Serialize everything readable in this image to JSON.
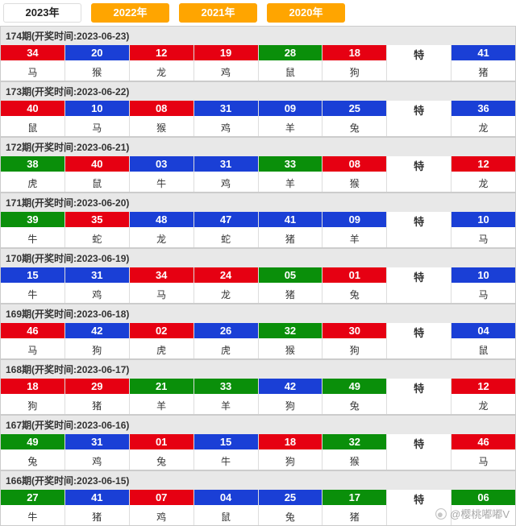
{
  "tabs": [
    "2023年",
    "2022年",
    "2021年",
    "2020年"
  ],
  "active_tab": 0,
  "special_label": "特",
  "watermark": "@樱桃嘟嘟V",
  "periods": [
    {
      "title": "174期(开奖时间:2023-06-23)",
      "balls": [
        {
          "n": "34",
          "z": "马",
          "c": "red"
        },
        {
          "n": "20",
          "z": "猴",
          "c": "blue"
        },
        {
          "n": "12",
          "z": "龙",
          "c": "red"
        },
        {
          "n": "19",
          "z": "鸡",
          "c": "red"
        },
        {
          "n": "28",
          "z": "鼠",
          "c": "green"
        },
        {
          "n": "18",
          "z": "狗",
          "c": "red"
        },
        {
          "n": "特",
          "z": "",
          "c": "spec"
        },
        {
          "n": "41",
          "z": "猪",
          "c": "blue"
        }
      ]
    },
    {
      "title": "173期(开奖时间:2023-06-22)",
      "balls": [
        {
          "n": "40",
          "z": "鼠",
          "c": "red"
        },
        {
          "n": "10",
          "z": "马",
          "c": "blue"
        },
        {
          "n": "08",
          "z": "猴",
          "c": "red"
        },
        {
          "n": "31",
          "z": "鸡",
          "c": "blue"
        },
        {
          "n": "09",
          "z": "羊",
          "c": "blue"
        },
        {
          "n": "25",
          "z": "兔",
          "c": "blue"
        },
        {
          "n": "特",
          "z": "",
          "c": "spec"
        },
        {
          "n": "36",
          "z": "龙",
          "c": "blue"
        }
      ]
    },
    {
      "title": "172期(开奖时间:2023-06-21)",
      "balls": [
        {
          "n": "38",
          "z": "虎",
          "c": "green"
        },
        {
          "n": "40",
          "z": "鼠",
          "c": "red"
        },
        {
          "n": "03",
          "z": "牛",
          "c": "blue"
        },
        {
          "n": "31",
          "z": "鸡",
          "c": "blue"
        },
        {
          "n": "33",
          "z": "羊",
          "c": "green"
        },
        {
          "n": "08",
          "z": "猴",
          "c": "red"
        },
        {
          "n": "特",
          "z": "",
          "c": "spec"
        },
        {
          "n": "12",
          "z": "龙",
          "c": "red"
        }
      ]
    },
    {
      "title": "171期(开奖时间:2023-06-20)",
      "balls": [
        {
          "n": "39",
          "z": "牛",
          "c": "green"
        },
        {
          "n": "35",
          "z": "蛇",
          "c": "red"
        },
        {
          "n": "48",
          "z": "龙",
          "c": "blue"
        },
        {
          "n": "47",
          "z": "蛇",
          "c": "blue"
        },
        {
          "n": "41",
          "z": "猪",
          "c": "blue"
        },
        {
          "n": "09",
          "z": "羊",
          "c": "blue"
        },
        {
          "n": "特",
          "z": "",
          "c": "spec"
        },
        {
          "n": "10",
          "z": "马",
          "c": "blue"
        }
      ]
    },
    {
      "title": "170期(开奖时间:2023-06-19)",
      "balls": [
        {
          "n": "15",
          "z": "牛",
          "c": "blue"
        },
        {
          "n": "31",
          "z": "鸡",
          "c": "blue"
        },
        {
          "n": "34",
          "z": "马",
          "c": "red"
        },
        {
          "n": "24",
          "z": "龙",
          "c": "red"
        },
        {
          "n": "05",
          "z": "猪",
          "c": "green"
        },
        {
          "n": "01",
          "z": "兔",
          "c": "red"
        },
        {
          "n": "特",
          "z": "",
          "c": "spec"
        },
        {
          "n": "10",
          "z": "马",
          "c": "blue"
        }
      ]
    },
    {
      "title": "169期(开奖时间:2023-06-18)",
      "balls": [
        {
          "n": "46",
          "z": "马",
          "c": "red"
        },
        {
          "n": "42",
          "z": "狗",
          "c": "blue"
        },
        {
          "n": "02",
          "z": "虎",
          "c": "red"
        },
        {
          "n": "26",
          "z": "虎",
          "c": "blue"
        },
        {
          "n": "32",
          "z": "猴",
          "c": "green"
        },
        {
          "n": "30",
          "z": "狗",
          "c": "red"
        },
        {
          "n": "特",
          "z": "",
          "c": "spec"
        },
        {
          "n": "04",
          "z": "鼠",
          "c": "blue"
        }
      ]
    },
    {
      "title": "168期(开奖时间:2023-06-17)",
      "balls": [
        {
          "n": "18",
          "z": "狗",
          "c": "red"
        },
        {
          "n": "29",
          "z": "猪",
          "c": "red"
        },
        {
          "n": "21",
          "z": "羊",
          "c": "green"
        },
        {
          "n": "33",
          "z": "羊",
          "c": "green"
        },
        {
          "n": "42",
          "z": "狗",
          "c": "blue"
        },
        {
          "n": "49",
          "z": "兔",
          "c": "green"
        },
        {
          "n": "特",
          "z": "",
          "c": "spec"
        },
        {
          "n": "12",
          "z": "龙",
          "c": "red"
        }
      ]
    },
    {
      "title": "167期(开奖时间:2023-06-16)",
      "balls": [
        {
          "n": "49",
          "z": "兔",
          "c": "green"
        },
        {
          "n": "31",
          "z": "鸡",
          "c": "blue"
        },
        {
          "n": "01",
          "z": "兔",
          "c": "red"
        },
        {
          "n": "15",
          "z": "牛",
          "c": "blue"
        },
        {
          "n": "18",
          "z": "狗",
          "c": "red"
        },
        {
          "n": "32",
          "z": "猴",
          "c": "green"
        },
        {
          "n": "特",
          "z": "",
          "c": "spec"
        },
        {
          "n": "46",
          "z": "马",
          "c": "red"
        }
      ]
    },
    {
      "title": "166期(开奖时间:2023-06-15)",
      "balls": [
        {
          "n": "27",
          "z": "牛",
          "c": "green"
        },
        {
          "n": "41",
          "z": "猪",
          "c": "blue"
        },
        {
          "n": "07",
          "z": "鸡",
          "c": "red"
        },
        {
          "n": "04",
          "z": "鼠",
          "c": "blue"
        },
        {
          "n": "25",
          "z": "兔",
          "c": "blue"
        },
        {
          "n": "17",
          "z": "猪",
          "c": "green"
        },
        {
          "n": "特",
          "z": "",
          "c": "spec"
        },
        {
          "n": "06",
          "z": "",
          "c": "green"
        }
      ]
    }
  ]
}
